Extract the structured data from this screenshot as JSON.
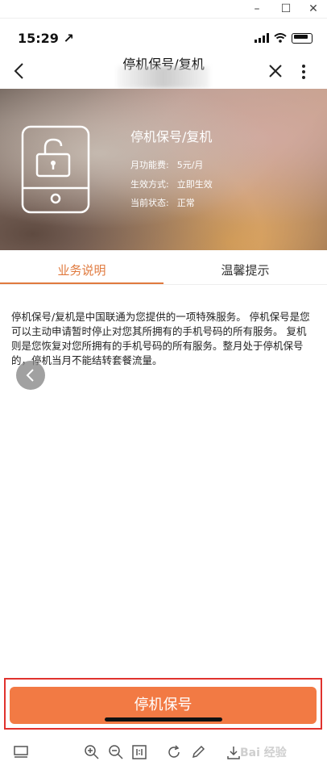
{
  "window": {
    "minimize": "–",
    "maximize": "☐",
    "close": "✕"
  },
  "status_bar": {
    "time": "15:29 ↗"
  },
  "nav": {
    "title": "停机保号/复机"
  },
  "banner": {
    "title": "停机保号/复机",
    "fee_label": "月功能费:",
    "fee_value": "5元/月",
    "effect_label": "生效方式:",
    "effect_value": "立即生效",
    "state_label": "当前状态:",
    "state_value": "正常"
  },
  "tabs": [
    {
      "label": "业务说明",
      "active": true
    },
    {
      "label": "温馨提示",
      "active": false
    }
  ],
  "description": "停机保号/复机是中国联通为您提供的一项特殊服务。 停机保号是您可以主动申请暂时停止对您其所拥有的手机号码的所有服务。 复机则是您恢复对您所拥有的手机号码的所有服务。整月处于停机保号的，停机当月不能结转套餐流量。",
  "main_button": {
    "label": "停机保号"
  },
  "watermark": {
    "text": "Bai 经验"
  },
  "colors": {
    "accent": "#f27a44",
    "tab_active": "#e07a3e",
    "highlight_frame": "#e0322e"
  }
}
